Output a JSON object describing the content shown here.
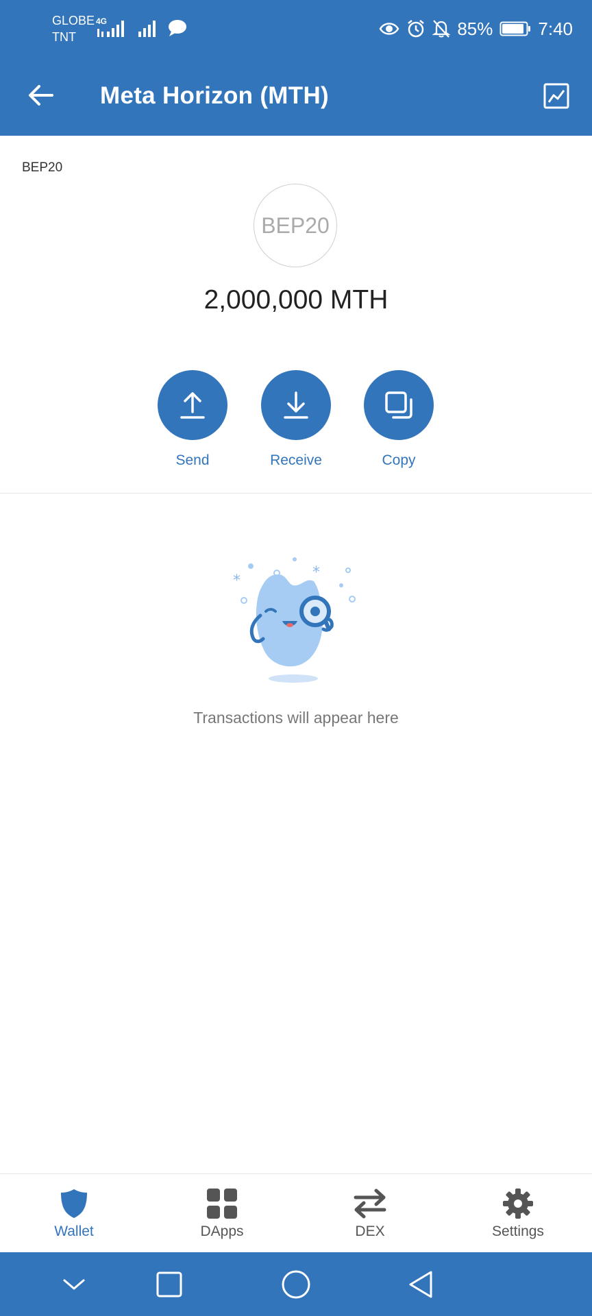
{
  "status_bar": {
    "carrier_line1": "GLOBE",
    "carrier_line2": "TNT",
    "network_type": "4G",
    "battery": "85%",
    "time": "7:40"
  },
  "header": {
    "title": "Meta Horizon (MTH)"
  },
  "token": {
    "network": "BEP20",
    "logo_text": "BEP20",
    "balance": "2,000,000 MTH"
  },
  "actions": {
    "send": "Send",
    "receive": "Receive",
    "copy": "Copy"
  },
  "transactions": {
    "empty_message": "Transactions will appear here"
  },
  "bottom_nav": {
    "wallet": "Wallet",
    "dapps": "DApps",
    "dex": "DEX",
    "settings": "Settings"
  },
  "colors": {
    "primary": "#3375BB",
    "text": "#222222",
    "muted": "#777777",
    "nav_inactive": "#555555"
  }
}
